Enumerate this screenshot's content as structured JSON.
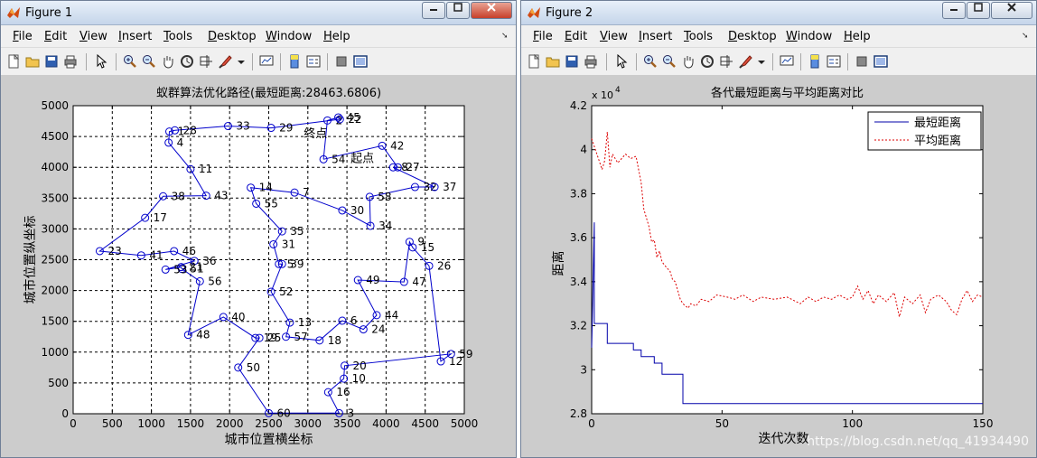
{
  "figure1": {
    "title": "Figure 1",
    "menus": [
      {
        "pre": "",
        "u": "F",
        "post": "ile"
      },
      {
        "pre": "",
        "u": "E",
        "post": "dit"
      },
      {
        "pre": "",
        "u": "V",
        "post": "iew"
      },
      {
        "pre": "",
        "u": "I",
        "post": "nsert"
      },
      {
        "pre": "",
        "u": "T",
        "post": "ools"
      },
      {
        "pre": "",
        "u": "D",
        "post": "esktop"
      },
      {
        "pre": "",
        "u": "W",
        "post": "indow"
      },
      {
        "pre": "",
        "u": "H",
        "post": "elp"
      }
    ],
    "chart": {
      "title": "蚁群算法优化路径(最短距离:28463.6806)",
      "xlabel": "城市位置横坐标",
      "ylabel": "城市位置纵坐标",
      "x_ticks": [
        "0",
        "500",
        "1000",
        "1500",
        "2000",
        "2500",
        "3000",
        "3500",
        "4000",
        "4500",
        "5000"
      ],
      "y_ticks": [
        "0",
        "500",
        "1000",
        "1500",
        "2000",
        "2500",
        "3000",
        "3500",
        "4000",
        "4500",
        "5000"
      ],
      "start_label": "起点",
      "end_label": "终点"
    }
  },
  "figure2": {
    "title": "Figure 2",
    "menus": [
      {
        "pre": "",
        "u": "F",
        "post": "ile"
      },
      {
        "pre": "",
        "u": "E",
        "post": "dit"
      },
      {
        "pre": "",
        "u": "V",
        "post": "iew"
      },
      {
        "pre": "",
        "u": "I",
        "post": "nsert"
      },
      {
        "pre": "",
        "u": "T",
        "post": "ools"
      },
      {
        "pre": "",
        "u": "D",
        "post": "esktop"
      },
      {
        "pre": "",
        "u": "W",
        "post": "indow"
      },
      {
        "pre": "",
        "u": "H",
        "post": "elp"
      }
    ],
    "chart": {
      "title": "各代最短距离与平均距离对比",
      "xlabel": "迭代次数",
      "ylabel": "距离",
      "exponent": "x 10",
      "exponent_power": "4",
      "x_ticks": [
        "0",
        "50",
        "100",
        "150"
      ],
      "y_ticks": [
        "2.8",
        "3",
        "3.2",
        "3.4",
        "3.6",
        "3.8",
        "4",
        "4.2"
      ],
      "legend": [
        "最短距离",
        "平均距离"
      ],
      "watermark": "https://blog.csdn.net/qq_41934490"
    }
  },
  "colors": {
    "line_shortest": "#0000aa",
    "line_average": "#dd0000",
    "path": "#0000cc"
  },
  "chart_data": [
    {
      "type": "scatter",
      "title": "蚁群算法优化路径(最短距离:28463.6806)",
      "xlabel": "城市位置横坐标",
      "ylabel": "城市位置纵坐标",
      "xlim": [
        0,
        5000
      ],
      "ylim": [
        0,
        5000
      ],
      "grid": true,
      "points": [
        {
          "id": "1",
          "x": 1230,
          "y": 4580
        },
        {
          "id": "2",
          "x": 3250,
          "y": 4760
        },
        {
          "id": "3",
          "x": 3400,
          "y": 10
        },
        {
          "id": "4",
          "x": 1220,
          "y": 4400
        },
        {
          "id": "5",
          "x": 2630,
          "y": 2430
        },
        {
          "id": "6",
          "x": 3440,
          "y": 1510
        },
        {
          "id": "7",
          "x": 2830,
          "y": 3590
        },
        {
          "id": "8",
          "x": 4090,
          "y": 4000
        },
        {
          "id": "9",
          "x": 4300,
          "y": 2790
        },
        {
          "id": "10",
          "x": 3460,
          "y": 570
        },
        {
          "id": "11",
          "x": 1500,
          "y": 3970
        },
        {
          "id": "12",
          "x": 4700,
          "y": 850
        },
        {
          "id": "13",
          "x": 2770,
          "y": 1480
        },
        {
          "id": "14",
          "x": 2270,
          "y": 3670
        },
        {
          "id": "15",
          "x": 4340,
          "y": 2700
        },
        {
          "id": "16",
          "x": 3260,
          "y": 350
        },
        {
          "id": "17",
          "x": 920,
          "y": 3180
        },
        {
          "id": "18",
          "x": 3150,
          "y": 1190
        },
        {
          "id": "19",
          "x": 2330,
          "y": 1230
        },
        {
          "id": "20",
          "x": 3470,
          "y": 780
        },
        {
          "id": "21",
          "x": 1380,
          "y": 2380
        },
        {
          "id": "22",
          "x": 3410,
          "y": 4780
        },
        {
          "id": "23",
          "x": 340,
          "y": 2640
        },
        {
          "id": "24",
          "x": 3710,
          "y": 1370
        },
        {
          "id": "25",
          "x": 2380,
          "y": 1230
        },
        {
          "id": "26",
          "x": 4550,
          "y": 2400
        },
        {
          "id": "27",
          "x": 4150,
          "y": 4000
        },
        {
          "id": "28",
          "x": 1300,
          "y": 4600
        },
        {
          "id": "29",
          "x": 2530,
          "y": 4640
        },
        {
          "id": "30",
          "x": 3440,
          "y": 3300
        },
        {
          "id": "31",
          "x": 2560,
          "y": 2750
        },
        {
          "id": "32",
          "x": 4370,
          "y": 3680
        },
        {
          "id": "33",
          "x": 1980,
          "y": 4670
        },
        {
          "id": "34",
          "x": 3800,
          "y": 3050
        },
        {
          "id": "35",
          "x": 2670,
          "y": 2960
        },
        {
          "id": "36",
          "x": 1550,
          "y": 2480
        },
        {
          "id": "37",
          "x": 4620,
          "y": 3680
        },
        {
          "id": "38",
          "x": 1150,
          "y": 3530
        },
        {
          "id": "39",
          "x": 2670,
          "y": 2430
        },
        {
          "id": "40",
          "x": 1920,
          "y": 1570
        },
        {
          "id": "41",
          "x": 870,
          "y": 2570
        },
        {
          "id": "42",
          "x": 3950,
          "y": 4350
        },
        {
          "id": "43",
          "x": 1700,
          "y": 3540
        },
        {
          "id": "44",
          "x": 3880,
          "y": 1600
        },
        {
          "id": "45",
          "x": 3390,
          "y": 4810
        },
        {
          "id": "46",
          "x": 1290,
          "y": 2640
        },
        {
          "id": "47",
          "x": 4230,
          "y": 2140
        },
        {
          "id": "48",
          "x": 1470,
          "y": 1280
        },
        {
          "id": "49",
          "x": 3640,
          "y": 2170
        },
        {
          "id": "50",
          "x": 2110,
          "y": 750
        },
        {
          "id": "51",
          "x": 1390,
          "y": 2350
        },
        {
          "id": "52",
          "x": 2530,
          "y": 1980
        },
        {
          "id": "53",
          "x": 1180,
          "y": 2340
        },
        {
          "id": "54",
          "x": 3200,
          "y": 4130
        },
        {
          "id": "55",
          "x": 2340,
          "y": 3410
        },
        {
          "id": "56",
          "x": 1620,
          "y": 2150
        },
        {
          "id": "57",
          "x": 2720,
          "y": 1250
        },
        {
          "id": "58",
          "x": 3790,
          "y": 3520
        },
        {
          "id": "59",
          "x": 4830,
          "y": 970
        },
        {
          "id": "60",
          "x": 2500,
          "y": 10
        }
      ],
      "path": [
        "54",
        "2",
        "45",
        "22",
        "29",
        "33",
        "28",
        "1",
        "4",
        "11",
        "43",
        "38",
        "17",
        "23",
        "41",
        "46",
        "36",
        "53",
        "21",
        "51",
        "56",
        "48",
        "40",
        "19",
        "25",
        "50",
        "60",
        "3",
        "16",
        "10",
        "20",
        "59",
        "12",
        "26",
        "15",
        "9",
        "47",
        "49",
        "44",
        "24",
        "6",
        "18",
        "57",
        "13",
        "52",
        "39",
        "5",
        "31",
        "35",
        "55",
        "14",
        "7",
        "30",
        "34",
        "58",
        "32",
        "37",
        "8",
        "27",
        "42",
        "54"
      ],
      "annotations": [
        {
          "text": "起点",
          "at": "54"
        },
        {
          "text": "终点",
          "at": "22"
        }
      ]
    },
    {
      "type": "line",
      "title": "各代最短距离与平均距离对比",
      "xlabel": "迭代次数",
      "ylabel": "距离",
      "xlim": [
        0,
        150
      ],
      "ylim": [
        28000,
        42000
      ],
      "y_scale_note": "x 10^4",
      "legend_position": "top-right",
      "series": [
        {
          "name": "最短距离",
          "style": "solid",
          "points": [
            [
              0,
              31000
            ],
            [
              1,
              36700
            ],
            [
              1,
              32100
            ],
            [
              2,
              32100
            ],
            [
              6,
              32100
            ],
            [
              6,
              31200
            ],
            [
              16,
              31200
            ],
            [
              16,
              30900
            ],
            [
              19,
              30900
            ],
            [
              19,
              30600
            ],
            [
              24,
              30600
            ],
            [
              24,
              30300
            ],
            [
              27,
              30300
            ],
            [
              27,
              29800
            ],
            [
              35,
              29800
            ],
            [
              35,
              28463.68
            ],
            [
              150,
              28463.68
            ]
          ]
        },
        {
          "name": "平均距离",
          "style": "dashed",
          "points": [
            [
              0,
              40500
            ],
            [
              2,
              39800
            ],
            [
              4,
              39100
            ],
            [
              5,
              39500
            ],
            [
              6,
              40800
            ],
            [
              7,
              39200
            ],
            [
              8,
              39800
            ],
            [
              10,
              39400
            ],
            [
              13,
              39800
            ],
            [
              15,
              39600
            ],
            [
              17,
              39700
            ],
            [
              19,
              38500
            ],
            [
              20,
              37300
            ],
            [
              22,
              36500
            ],
            [
              23,
              35800
            ],
            [
              24,
              35900
            ],
            [
              25,
              35100
            ],
            [
              26,
              35400
            ],
            [
              27,
              34900
            ],
            [
              29,
              34600
            ],
            [
              30,
              34500
            ],
            [
              31,
              34100
            ],
            [
              32,
              34000
            ],
            [
              33,
              33600
            ],
            [
              34,
              33200
            ],
            [
              35,
              33000
            ],
            [
              36,
              32900
            ],
            [
              37,
              32800
            ],
            [
              38,
              33000
            ],
            [
              40,
              32900
            ],
            [
              42,
              33200
            ],
            [
              45,
              33100
            ],
            [
              48,
              33400
            ],
            [
              52,
              33300
            ],
            [
              55,
              33200
            ],
            [
              58,
              33400
            ],
            [
              62,
              33100
            ],
            [
              65,
              33300
            ],
            [
              70,
              33200
            ],
            [
              75,
              33300
            ],
            [
              80,
              33000
            ],
            [
              83,
              33300
            ],
            [
              86,
              33100
            ],
            [
              89,
              33300
            ],
            [
              92,
              33200
            ],
            [
              95,
              33400
            ],
            [
              98,
              33200
            ],
            [
              100,
              33300
            ],
            [
              102,
              33800
            ],
            [
              104,
              33200
            ],
            [
              106,
              33600
            ],
            [
              108,
              33000
            ],
            [
              110,
              33400
            ],
            [
              113,
              33100
            ],
            [
              116,
              33500
            ],
            [
              118,
              32400
            ],
            [
              120,
              33300
            ],
            [
              123,
              33000
            ],
            [
              126,
              33400
            ],
            [
              128,
              32600
            ],
            [
              130,
              33200
            ],
            [
              133,
              33400
            ],
            [
              136,
              33100
            ],
            [
              138,
              32700
            ],
            [
              140,
              32500
            ],
            [
              142,
              33200
            ],
            [
              144,
              33600
            ],
            [
              146,
              33100
            ],
            [
              148,
              33400
            ],
            [
              150,
              33300
            ]
          ]
        }
      ]
    }
  ]
}
